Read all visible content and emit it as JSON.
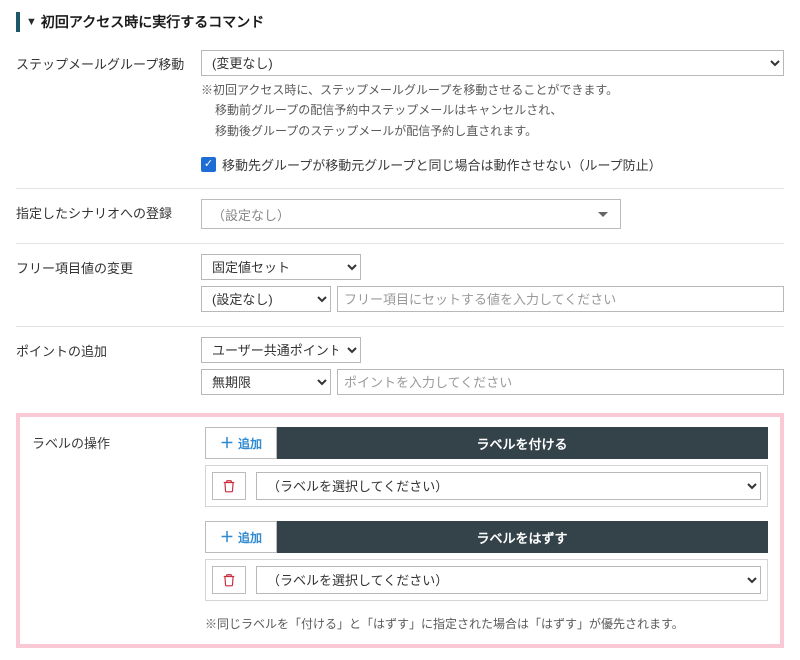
{
  "section_title": "初回アクセス時に実行するコマンド",
  "stepmail": {
    "label": "ステップメールグループ移動",
    "select_value": "(変更なし)",
    "note_prefix": "※初回アクセス時に、ステップメールグループを移動させることができます。",
    "note_line2": "移動前グループの配信予約中ステップメールはキャンセルされ、",
    "note_line3": "移動後グループのステップメールが配信予約し直されます。",
    "checkbox_label": "移動先グループが移動元グループと同じ場合は動作させない（ループ防止）"
  },
  "scenario": {
    "label": "指定したシナリオへの登録",
    "placeholder": "（設定なし）"
  },
  "freeitem": {
    "label": "フリー項目値の変更",
    "mode": "固定値セット",
    "field": "(設定なし)",
    "value_placeholder": "フリー項目にセットする値を入力してください"
  },
  "points": {
    "label": "ポイントの追加",
    "type": "ユーザー共通ポイント",
    "expire": "無期限",
    "value_placeholder": "ポイントを入力してください"
  },
  "labels": {
    "row_label": "ラベルの操作",
    "add_btn": "追加",
    "attach_header": "ラベルを付ける",
    "detach_header": "ラベルをはずす",
    "select_placeholder": "（ラベルを選択してください）",
    "footer_note": "※同じラベルを「付ける」と「はずす」に指定された場合は「はずす」が優先されます。"
  }
}
